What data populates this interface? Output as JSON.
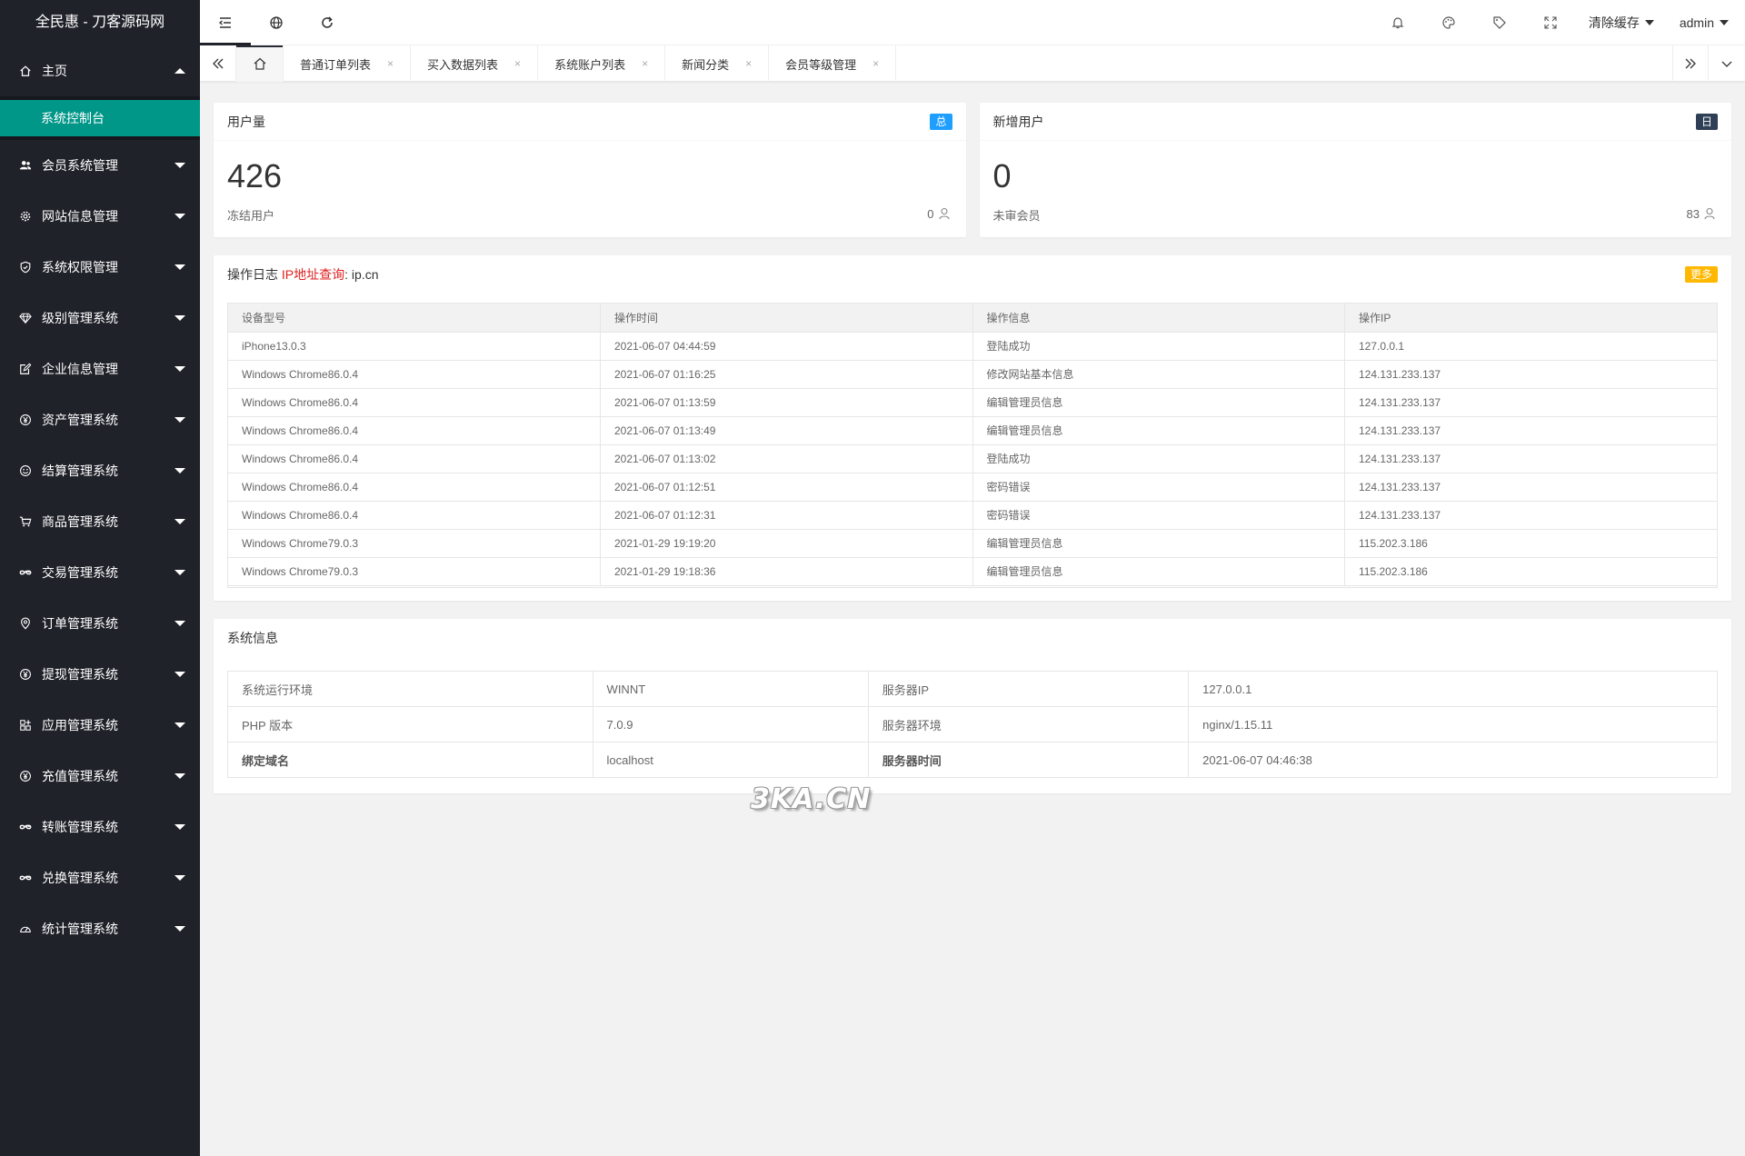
{
  "app": {
    "title": "全民惠 - 刀客源码网"
  },
  "sidebar": {
    "home": {
      "label": "主页",
      "icon": "home-icon"
    },
    "home_sub": {
      "label": "系统控制台"
    },
    "items": [
      {
        "label": "会员系统管理",
        "icon": "users-icon"
      },
      {
        "label": "网站信息管理",
        "icon": "gear-icon"
      },
      {
        "label": "系统权限管理",
        "icon": "shield-icon"
      },
      {
        "label": "级别管理系统",
        "icon": "diamond-icon"
      },
      {
        "label": "企业信息管理",
        "icon": "edit-icon"
      },
      {
        "label": "资产管理系统",
        "icon": "yen-icon"
      },
      {
        "label": "结算管理系统",
        "icon": "smile-icon"
      },
      {
        "label": "商品管理系统",
        "icon": "cart-icon"
      },
      {
        "label": "交易管理系统",
        "icon": "link-icon"
      },
      {
        "label": "订单管理系统",
        "icon": "location-icon"
      },
      {
        "label": "提现管理系统",
        "icon": "yen-icon"
      },
      {
        "label": "应用管理系统",
        "icon": "apps-icon"
      },
      {
        "label": "充值管理系统",
        "icon": "yen-icon"
      },
      {
        "label": "转账管理系统",
        "icon": "link-icon"
      },
      {
        "label": "兑换管理系统",
        "icon": "link-icon"
      },
      {
        "label": "统计管理系统",
        "icon": "dashboard-icon"
      }
    ]
  },
  "header": {
    "clear_cache": "清除缓存",
    "user": "admin"
  },
  "tabs": [
    {
      "label": "普通订单列表"
    },
    {
      "label": "买入数据列表"
    },
    {
      "label": "系统账户列表"
    },
    {
      "label": "新闻分类"
    },
    {
      "label": "会员等级管理"
    }
  ],
  "tab_close": "×",
  "stats": {
    "users": {
      "title": "用户量",
      "badge": "总",
      "value": "426",
      "sub": "冻结用户",
      "right_value": "0"
    },
    "new_users": {
      "title": "新增用户",
      "badge": "日",
      "value": "0",
      "sub": "未审会员",
      "right_value": "83"
    }
  },
  "log": {
    "title": "操作日志",
    "ip_link": "IP地址查询",
    "ip_site": ": ip.cn",
    "more": "更多",
    "columns": [
      "设备型号",
      "操作时间",
      "操作信息",
      "操作IP"
    ],
    "rows": [
      [
        "iPhone13.0.3",
        "2021-06-07 04:44:59",
        "登陆成功",
        "127.0.0.1"
      ],
      [
        "Windows Chrome86.0.4",
        "2021-06-07 01:16:25",
        "修改网站基本信息",
        "124.131.233.137"
      ],
      [
        "Windows Chrome86.0.4",
        "2021-06-07 01:13:59",
        "编辑管理员信息",
        "124.131.233.137"
      ],
      [
        "Windows Chrome86.0.4",
        "2021-06-07 01:13:49",
        "编辑管理员信息",
        "124.131.233.137"
      ],
      [
        "Windows Chrome86.0.4",
        "2021-06-07 01:13:02",
        "登陆成功",
        "124.131.233.137"
      ],
      [
        "Windows Chrome86.0.4",
        "2021-06-07 01:12:51",
        "密码错误",
        "124.131.233.137"
      ],
      [
        "Windows Chrome86.0.4",
        "2021-06-07 01:12:31",
        "密码错误",
        "124.131.233.137"
      ],
      [
        "Windows Chrome79.0.3",
        "2021-01-29 19:19:20",
        "编辑管理员信息",
        "115.202.3.186"
      ],
      [
        "Windows Chrome79.0.3",
        "2021-01-29 19:18:36",
        "编辑管理员信息",
        "115.202.3.186"
      ]
    ]
  },
  "sysinfo": {
    "title": "系统信息",
    "rows": [
      [
        "系统运行环境",
        "WINNT",
        "服务器IP",
        "127.0.0.1"
      ],
      [
        "PHP 版本",
        "7.0.9",
        "服务器环境",
        "nginx/1.15.11"
      ],
      [
        "绑定域名",
        "localhost",
        "服务器时间",
        "2021-06-07 04:46:38"
      ]
    ]
  },
  "watermark": "3KA.CN"
}
